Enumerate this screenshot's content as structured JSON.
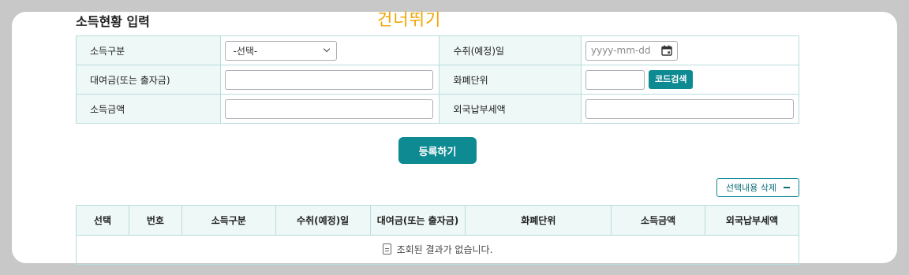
{
  "skip_link": "건너뛰기",
  "section_title": "소득현황 입력",
  "form": {
    "income_type_label": "소득구분",
    "income_type_value": "-선택-",
    "receipt_date_label": "수취(예정)일",
    "receipt_date_placeholder": "yyyy-mm-dd",
    "loan_label": "대여금(또는 출자금)",
    "loan_value": "",
    "currency_label": "화폐단위",
    "currency_value": "",
    "code_search_label": "코드검색",
    "income_amount_label": "소득금액",
    "income_amount_value": "",
    "foreign_tax_label": "외국납부세액",
    "foreign_tax_value": ""
  },
  "register_button": "등록하기",
  "delete_selected_button": "선택내용 삭제",
  "table": {
    "columns": [
      "선택",
      "번호",
      "소득구분",
      "수취(예정)일",
      "대여금(또는 출자금)",
      "화폐단위",
      "소득금액",
      "외국납부세액"
    ],
    "empty_message": "조회된 결과가 없습니다."
  },
  "colors": {
    "accent": "#0e8a92",
    "label_bg": "#eef8f7",
    "border": "#b8dcdc",
    "skip_link": "#f0a500"
  },
  "icons": [
    "chevron-down-icon",
    "calendar-icon",
    "minus-icon",
    "document-icon"
  ]
}
